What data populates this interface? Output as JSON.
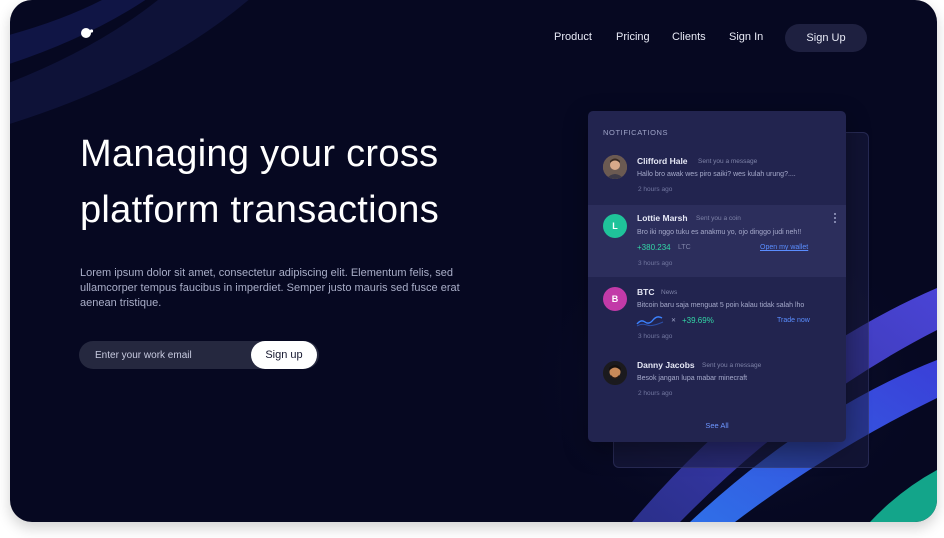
{
  "nav": {
    "links": [
      "Product",
      "Pricing",
      "Clients",
      "Sign In"
    ],
    "signup_label": "Sign Up"
  },
  "hero": {
    "title_line1": "Managing your cross",
    "title_line2": "platform transactions",
    "description": "Lorem ipsum dolor sit amet, consectetur adipiscing elit. Elementum felis, sed ullamcorper tempus faucibus in imperdiet. Semper justo mauris sed fusce erat aenean tristique.",
    "email_placeholder": "Enter your work email",
    "cta_label": "Sign up"
  },
  "notifications": {
    "header": "NOTIFICATIONS",
    "items": [
      {
        "name": "Clifford Hale",
        "meta": "Sent you a message",
        "message": "Hallo bro awak wes piro saiki? wes kulah urung?....",
        "time": "2 hours ago"
      },
      {
        "name": "Lottie Marsh",
        "meta": "Sent you a coin",
        "message": "Bro iki nggo tuku es anakmu yo, ojo dinggo judi neh!!",
        "initial": "L",
        "value": "+380.234",
        "unit": "LTC",
        "action": "Open my wallet",
        "time": "3 hours ago"
      },
      {
        "name": "BTC",
        "meta": "News",
        "message": "Bitcoin baru saja menguat 5 poin kalau tidak salah lho",
        "initial": "B",
        "change": "+39.69%",
        "action": "Trade now",
        "time": "3 hours ago"
      },
      {
        "name": "Danny Jacobs",
        "meta": "Sent you a message",
        "message": "Besok jangan lupa mabar minecraft",
        "time": "2 hours ago"
      }
    ],
    "see_all": "See All"
  },
  "colors": {
    "background": "#060821",
    "card": "#22244f",
    "accent_green": "#33d6a6",
    "accent_blue": "#5a8dff",
    "lottie_avatar": "#1fc39a",
    "btc_avatar": "#c23aa8"
  }
}
